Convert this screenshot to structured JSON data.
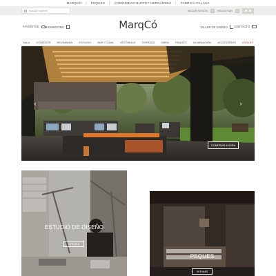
{
  "topbar": {
    "links": [
      "MARQCÓ",
      "PEQUES",
      "COMODIDAD BUFFET HERNÁNDEZ",
      "FÁBRICA CALASA"
    ]
  },
  "utility": {
    "search_placeholder": "Buscar mueble",
    "iniciar_sesion": "INICIAR SESIÓN",
    "registrar": "REGISTRAR"
  },
  "header": {
    "favorites_label": "FAVORITOS",
    "showroom_label": "SHOWROOMS",
    "logo_text": "MarqCó",
    "taller_label": "TALLER DE DISEÑO",
    "contact_label": "CONTACTO"
  },
  "nav": {
    "items": [
      "SALA",
      "COMEDOR",
      "RECÁMARA",
      "ESTUDIO",
      "BAR Y CAVA",
      "VESTÍBULO",
      "TERRAZA",
      "OBRA",
      "PEQUES",
      "ILUMINACIÓN",
      "ACCESORIOS",
      "OUTLET"
    ]
  },
  "hero": {
    "cta_label": "COMPRAR AHORA",
    "prev_glyph": "‹",
    "next_glyph": "›"
  },
  "cards": [
    {
      "title": "ESTUDIO DE DISEÑO",
      "button": "VER MÁS"
    },
    {
      "title": "PEQUES",
      "button": "VER MÁS"
    }
  ],
  "colors": {
    "utility_bg": "#efeeec",
    "outlet": "#c0392b",
    "hero_dark": "#1e2015"
  }
}
